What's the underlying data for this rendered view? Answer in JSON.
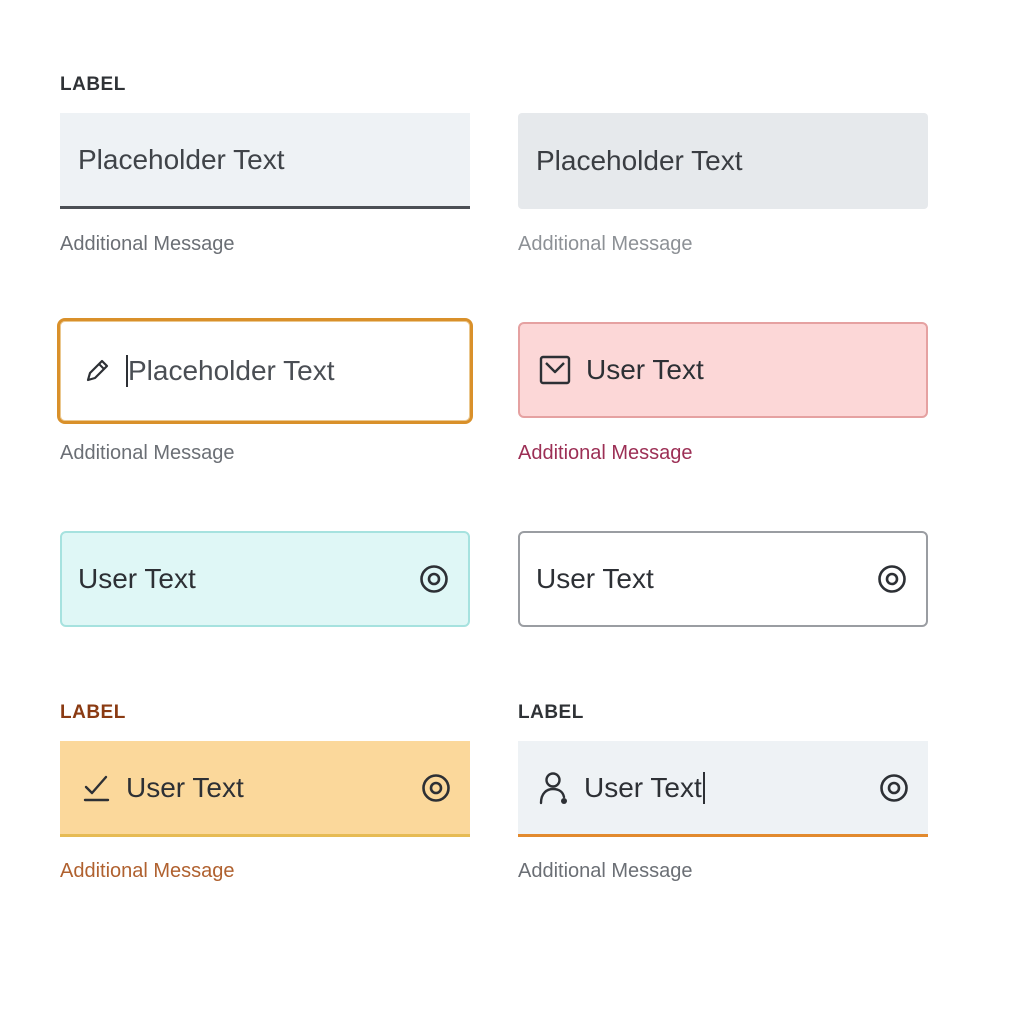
{
  "fields": [
    {
      "label": "LABEL",
      "text": "Placeholder Text",
      "message": "Additional Message"
    },
    {
      "text": "Placeholder Text",
      "message": "Additional Message"
    },
    {
      "text": "Placeholder Text",
      "message": "Additional Message",
      "leading_icon": "pencil-icon"
    },
    {
      "text": "User Text",
      "message": "Additional Message",
      "leading_icon": "mail-icon"
    },
    {
      "text": "User Text",
      "trailing_icon": "eye-icon"
    },
    {
      "text": "User Text",
      "trailing_icon": "eye-icon"
    },
    {
      "label": "LABEL",
      "text": "User Text",
      "message": "Additional Message",
      "leading_icon": "check-underline-icon",
      "trailing_icon": "eye-icon"
    },
    {
      "label": "LABEL",
      "text": "User Text",
      "message": "Additional Message",
      "leading_icon": "user-icon",
      "trailing_icon": "eye-icon"
    }
  ],
  "colors": {
    "focus_border": "#d9902a",
    "error_bg": "#fcd7d7",
    "success_bg": "#dff7f6",
    "warning_bg": "#fbd89b",
    "active_underline": "#e28a2e"
  }
}
